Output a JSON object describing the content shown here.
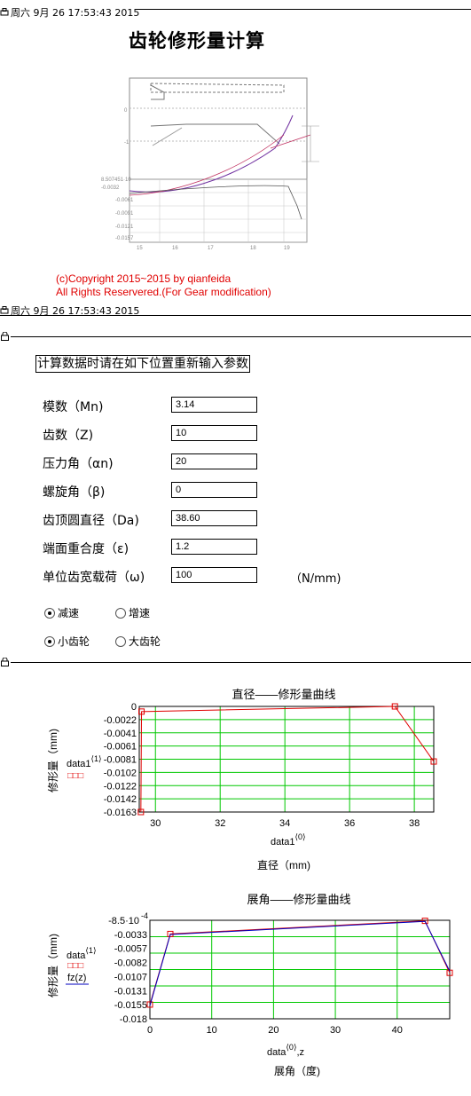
{
  "header1": {
    "timestamp": "周六 9月 26 17:53:43 2015"
  },
  "header2": {
    "timestamp": "周六 9月 26 17:53:43 2015"
  },
  "page_title": "齿轮修形量计算",
  "copyright": {
    "line1": "(c)Copyright 2015~2015 by qianfeida",
    "line2": "All Rights Reservered.(For Gear modification)"
  },
  "instruction": "计算数据时请在如下位置重新输入参数",
  "fields": [
    {
      "label": "模数（Mn)",
      "value": "3.14"
    },
    {
      "label": "齿数（Z)",
      "value": "10"
    },
    {
      "label": "压力角（αn)",
      "value": "20"
    },
    {
      "label": "螺旋角（β)",
      "value": "0"
    },
    {
      "label": "齿顶圆直径（Da)",
      "value": "38.60"
    },
    {
      "label": "端面重合度（ε)",
      "value": "1.2"
    },
    {
      "label": "单位齿宽载荷（ω)",
      "value": "100"
    }
  ],
  "load_unit": "（N/mm)",
  "radios": {
    "group1": [
      {
        "label": "减速",
        "checked": true
      },
      {
        "label": "增速",
        "checked": false
      }
    ],
    "group2": [
      {
        "label": "小齿轮",
        "checked": true
      },
      {
        "label": "大齿轮",
        "checked": false
      }
    ]
  },
  "colors": {
    "accent_red": "#e00000",
    "grid_green": "#00c800",
    "series_blue": "#0000c0"
  },
  "chart_data": [
    {
      "type": "line",
      "title": "直径——修形量曲线",
      "ylabel": "修形量（mm)",
      "xlabel": "直径（mm)",
      "x_var": "data1",
      "x_var_sup": "⟨0⟩",
      "legend": [
        {
          "name": "data1",
          "sup": "⟨1⟩",
          "marker": "□□□"
        }
      ],
      "xlim": [
        29.5,
        38.6
      ],
      "ylim": [
        -0.0163,
        0
      ],
      "xticks": [
        "30",
        "32",
        "34",
        "36",
        "38"
      ],
      "xtick_values": [
        30,
        32,
        34,
        36,
        38
      ],
      "yticks": [
        "0",
        "-0.0022",
        "-0.0041",
        "-0.0061",
        "-0.0081",
        "-0.0102",
        "-0.0122",
        "-0.0142",
        "-0.0163"
      ],
      "series": [
        {
          "name": "data1",
          "color": "#e00000",
          "x": [
            29.55,
            29.57,
            37.4,
            38.6
          ],
          "y": [
            -0.0163,
            -0.0008,
            0,
            -0.0085
          ]
        }
      ]
    },
    {
      "type": "line",
      "title": "展角——修形量曲线",
      "ylabel": "修形量（mm)",
      "xlabel": "展角（度)",
      "x_var": "data",
      "x_var_sup": "⟨0⟩",
      "x_var2": ",z",
      "legend": [
        {
          "name": "data",
          "sup": "⟨1⟩",
          "marker": "□□□"
        },
        {
          "name": "fz(z)",
          "sup": "",
          "marker": "——"
        }
      ],
      "xlim": [
        0,
        48.5
      ],
      "ylim": [
        -0.018,
        0
      ],
      "ytop_label": "-8.5·10",
      "ytop_exp": "-4",
      "xticks": [
        "0",
        "10",
        "20",
        "30",
        "40"
      ],
      "xtick_values": [
        0,
        10,
        20,
        30,
        40
      ],
      "yticks": [
        "-0.0033",
        "-0.0057",
        "-0.0082",
        "-0.0107",
        "-0.0131",
        "-0.0155",
        "-0.018"
      ],
      "series": [
        {
          "name": "data",
          "color": "#e00000",
          "x": [
            0,
            3.3,
            44.5,
            48.5
          ],
          "y": [
            -0.0154,
            -0.0025,
            -0.0001,
            -0.0096
          ]
        },
        {
          "name": "fz(z)",
          "color": "#0000c0",
          "x": [
            0,
            3.3,
            44.5,
            48.5
          ],
          "y": [
            -0.0156,
            -0.0026,
            -0.0002,
            -0.0093
          ]
        }
      ]
    }
  ]
}
